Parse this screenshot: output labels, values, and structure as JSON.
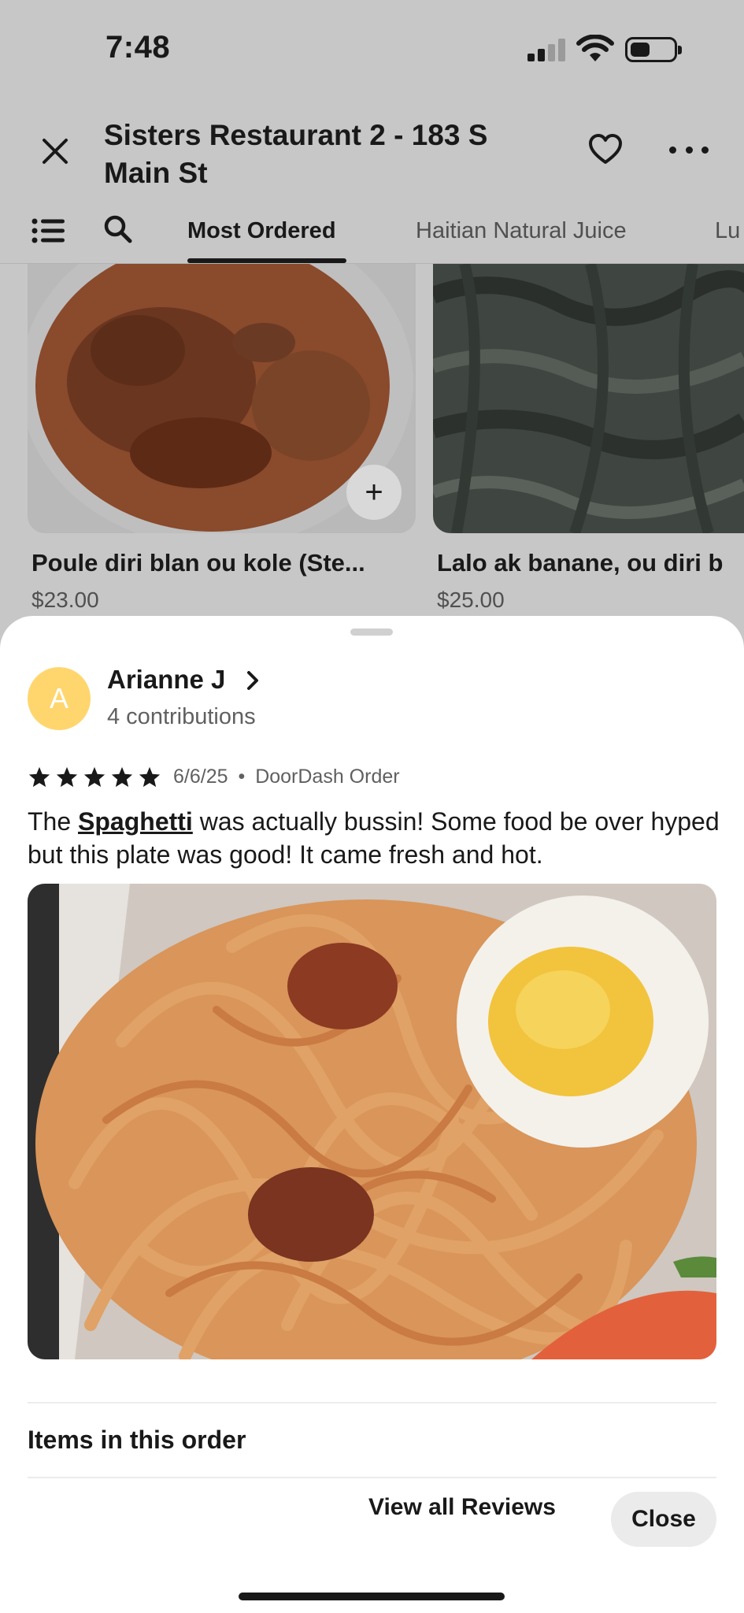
{
  "status_bar": {
    "time": "7:48"
  },
  "header": {
    "title": "Sisters Restaurant 2 - 183 S Main St"
  },
  "tabs": [
    {
      "label": "Most Ordered",
      "active": true
    },
    {
      "label": "Haitian Natural Juice",
      "active": false
    },
    {
      "label": "Lu",
      "active": false
    }
  ],
  "menu_items": [
    {
      "name": "Poule diri blan ou kole (Ste...",
      "price": "$23.00"
    },
    {
      "name": "Lalo ak banane, ou diri  b",
      "price": "$25.00"
    }
  ],
  "review": {
    "avatar_initial": "A",
    "reviewer_name": "Arianne J",
    "contributions": "4 contributions",
    "rating": 5,
    "date": "6/6/25",
    "separator": "•",
    "source": "DoorDash Order",
    "text_before": "The ",
    "highlighted_item": "Spaghetti",
    "text_after": " was actually bussin! Some food be over hyped but this plate was good! It came fresh and hot."
  },
  "sheet": {
    "items_heading": "Items in this order",
    "view_all_label": "View all Reviews",
    "close_label": "Close"
  },
  "colors": {
    "avatar": "#ffd66e",
    "text": "#191919",
    "muted": "#606060",
    "overlay": "#c7c7c7"
  }
}
